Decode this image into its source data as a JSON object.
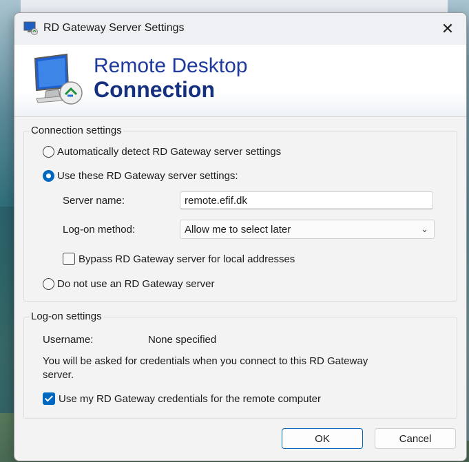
{
  "window": {
    "title": "RD Gateway Server Settings",
    "close_glyph": "✕"
  },
  "banner": {
    "line1": "Remote Desktop",
    "line2": "Connection"
  },
  "connection_settings": {
    "legend": "Connection settings",
    "radio_auto": {
      "label": "Automatically detect RD Gateway server settings",
      "selected": false
    },
    "radio_use": {
      "label": "Use these RD Gateway server settings:",
      "selected": true
    },
    "server_name_label": "Server name:",
    "server_name_value": "remote.efif.dk",
    "logon_method_label": "Log-on method:",
    "logon_method_value": "Allow me to select later",
    "bypass": {
      "label": "Bypass RD Gateway server for local addresses",
      "checked": false
    },
    "radio_none": {
      "label": "Do not use an RD Gateway server",
      "selected": false
    }
  },
  "logon_settings": {
    "legend": "Log-on settings",
    "username_label": "Username:",
    "username_value": "None specified",
    "note_line1": "You will be asked for credentials when you connect to this RD Gateway",
    "note_line2": "server.",
    "use_creds": {
      "label": "Use my RD Gateway credentials for the remote computer",
      "checked": true
    }
  },
  "buttons": {
    "ok": "OK",
    "cancel": "Cancel"
  },
  "colors": {
    "accent": "#0067c0",
    "banner_text": "#1d3a9c"
  }
}
